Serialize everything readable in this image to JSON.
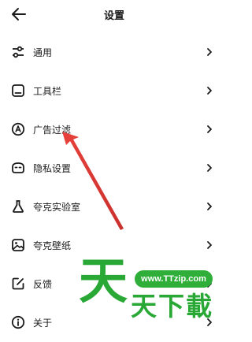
{
  "header": {
    "title": "设置"
  },
  "settings": {
    "items": [
      {
        "label": "通用",
        "icon": "sliders-icon"
      },
      {
        "label": "工具栏",
        "icon": "toolbar-icon"
      },
      {
        "label": "广告过滤",
        "icon": "ad-filter-icon"
      },
      {
        "label": "隐私设置",
        "icon": "privacy-mask-icon"
      },
      {
        "label": "夸克实验室",
        "icon": "flask-icon"
      },
      {
        "label": "夸克壁纸",
        "icon": "wallpaper-icon"
      },
      {
        "label": "反馈",
        "icon": "feedback-icon"
      },
      {
        "label": "关于",
        "icon": "info-icon"
      }
    ]
  },
  "watermark": {
    "url": "www.TTzip.com",
    "big_char": "天",
    "small_text": "天下載"
  },
  "colors": {
    "arrow": "#e8413b",
    "watermark": "#29a836",
    "text": "#1a1a1a"
  }
}
